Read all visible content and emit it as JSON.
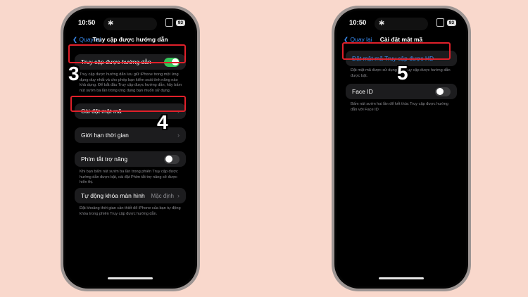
{
  "colors": {
    "background": "#f9d8cc",
    "highlight": "#e0202a",
    "accent": "#3b8ff6",
    "toggle_on": "#34c759"
  },
  "left": {
    "status": {
      "time": "10:50",
      "battery": "93"
    },
    "nav": {
      "back": "Quay lại",
      "title": "Truy cập được hướng dẫn"
    },
    "guided_access": {
      "label": "Truy cập được hướng dẫn",
      "toggle_on": true
    },
    "guided_access_desc": "Truy cập được hướng dẫn lưu giữ iPhone trong một ứng dụng duy nhất và cho phép bạn kiểm soát tính năng nào khả dụng. Để bắt đầu Truy cập được hướng dẫn, hãy bấm nút sườn ba lần trong ứng dụng bạn muốn sử dụng.",
    "passcode": {
      "label": "Cài đặt mật mã"
    },
    "time_limits": {
      "label": "Giới hạn thời gian"
    },
    "accessibility_shortcut": {
      "label": "Phím tắt trợ năng",
      "toggle_on": false
    },
    "accessibility_desc": "Khi bạn bấm nút sườn ba lần trong phiên Truy cập được hướng dẫn được bật, cài đặt Phím tắt trợ năng sẽ được hiển thị.",
    "auto_lock": {
      "label": "Tự động khóa màn hình",
      "value": "Mặc định"
    },
    "auto_lock_desc": "Đặt khoảng thời gian cần thiết để iPhone của bạn tự động khóa trong phiên Truy cập được hướng dẫn."
  },
  "right": {
    "status": {
      "time": "10:50",
      "battery": "93"
    },
    "nav": {
      "back": "Quay lại",
      "title": "Cài đặt mật mã"
    },
    "set_passcode": {
      "label": "Đặt mật mã Truy cập được HD"
    },
    "set_passcode_desc": "Đặt mật mã được sử dụng khi Truy cập được hướng dẫn được bật.",
    "face_id": {
      "label": "Face ID",
      "toggle_on": false
    },
    "face_id_desc": "Bấm nút sườn hai lần để kết thúc Truy cập được hướng dẫn với Face ID"
  },
  "steps": [
    "3",
    "4",
    "5"
  ]
}
